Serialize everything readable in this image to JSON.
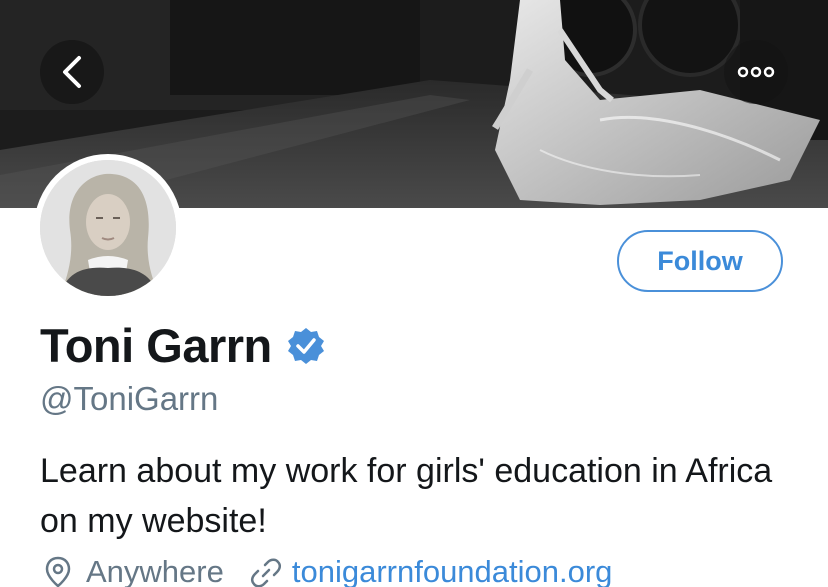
{
  "header": {
    "back_icon": "chevron-left-icon",
    "more_icon": "ellipsis-icon"
  },
  "profile": {
    "name": "Toni Garrn",
    "verified": true,
    "handle": "@ToniGarrn",
    "follow_label": "Follow",
    "bio": "Learn about my work for girls' education in Africa on my website!",
    "location": "Anywhere",
    "website": "tonigarrnfoundation.org"
  },
  "colors": {
    "accent": "#3b8ad9",
    "text_primary": "#14171a",
    "text_secondary": "#657786",
    "verified_badge": "#4a90d9"
  }
}
